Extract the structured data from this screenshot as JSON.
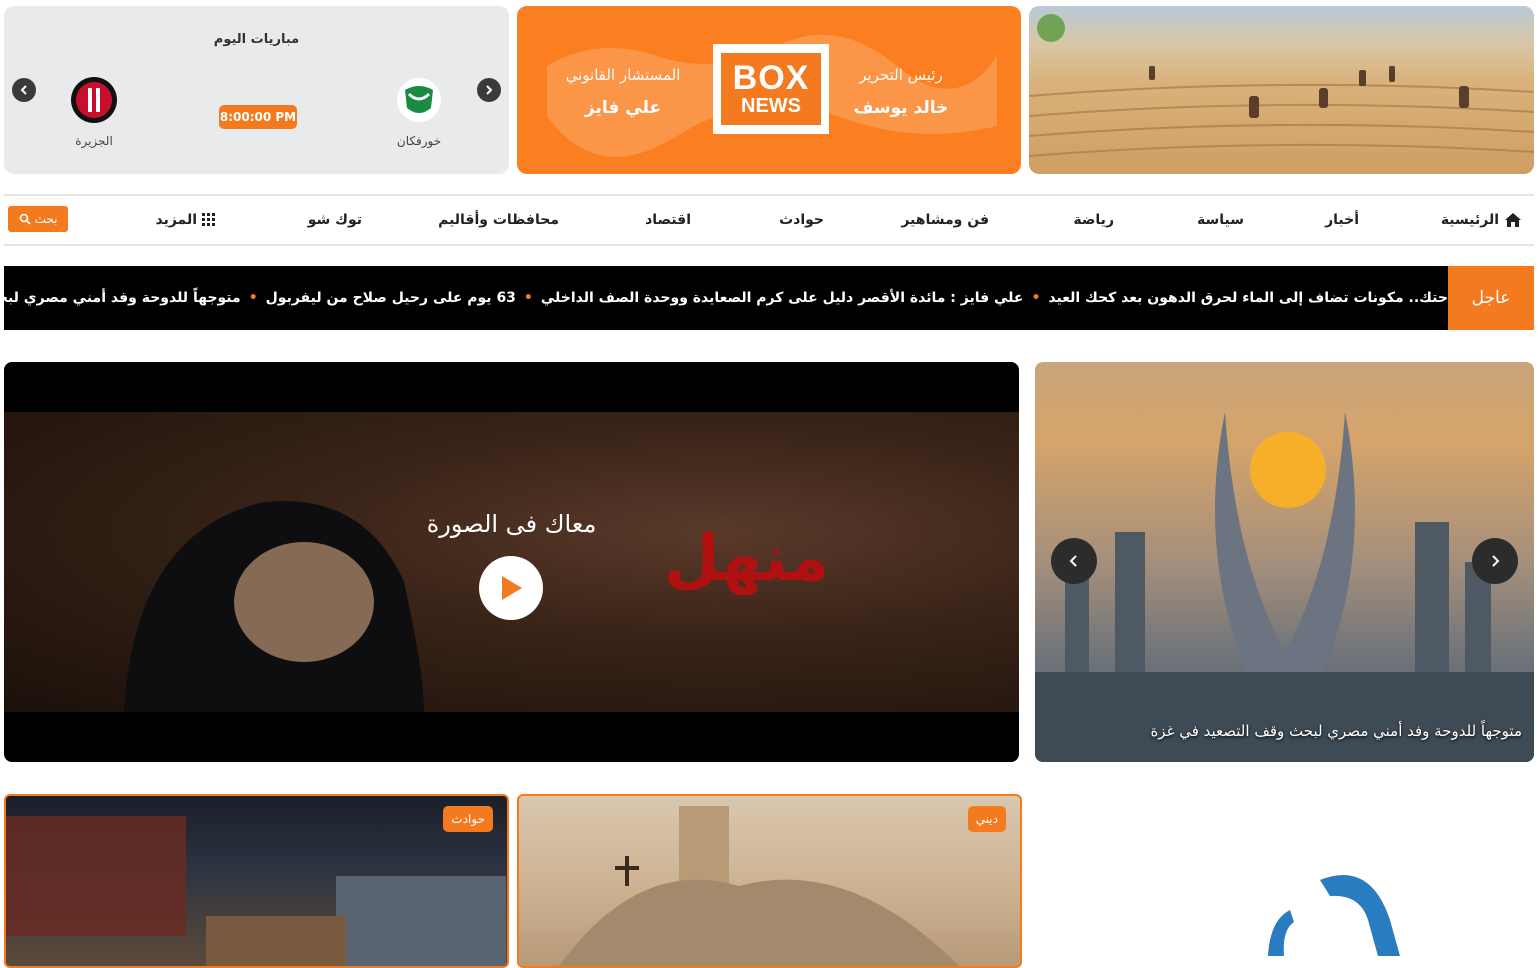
{
  "matches": {
    "title": "مباريات اليوم",
    "home_team": "خورفكان",
    "away_team": "الجزيرة",
    "time": "8:00:00 PM"
  },
  "boxnews": {
    "logo_top": "BOX",
    "logo_bottom": "NEWS",
    "editor_role": "رئيس التحرير",
    "editor_name": "خالد يوسف",
    "counsel_role": "المستشار القانوني",
    "counsel_name": "علي فايز"
  },
  "nav": {
    "home": "الرئيسية",
    "news": "أخبار",
    "politics": "سياسة",
    "sports": "رياضة",
    "art": "فن ومشاهير",
    "accidents": "حوادث",
    "economy": "اقتصاد",
    "governorates": "محافظات وأقاليم",
    "talkshow": "توك شو",
    "more": "المزيد",
    "search": "بحث"
  },
  "ticker": {
    "label": "عاجل",
    "items": [
      "حتك.. مكونات تضاف إلى الماء لحرق الدهون بعد كحك العيد",
      "علي فايز : مائدة الأقصر دليل على كرم الصعايدة ووحدة الصف الداخلي",
      "63 يوم على رحيل صلاح من ليفربول",
      "متوجهاً للدوحة وفد أمني مصري لبحث وقف"
    ]
  },
  "video": {
    "caption": "معاك فى الصورة",
    "overlay_word": "منهل"
  },
  "slider": {
    "caption": "متوجهاً للدوحة وفد أمني مصري لبحث وقف التصعيد في غزة"
  },
  "cards": [
    {
      "tag": "حوادث"
    },
    {
      "tag": "ديني"
    }
  ],
  "colors": {
    "accent": "#f47a1f",
    "ticker_bg": "#000000",
    "matches_bg": "#e9eaec"
  }
}
